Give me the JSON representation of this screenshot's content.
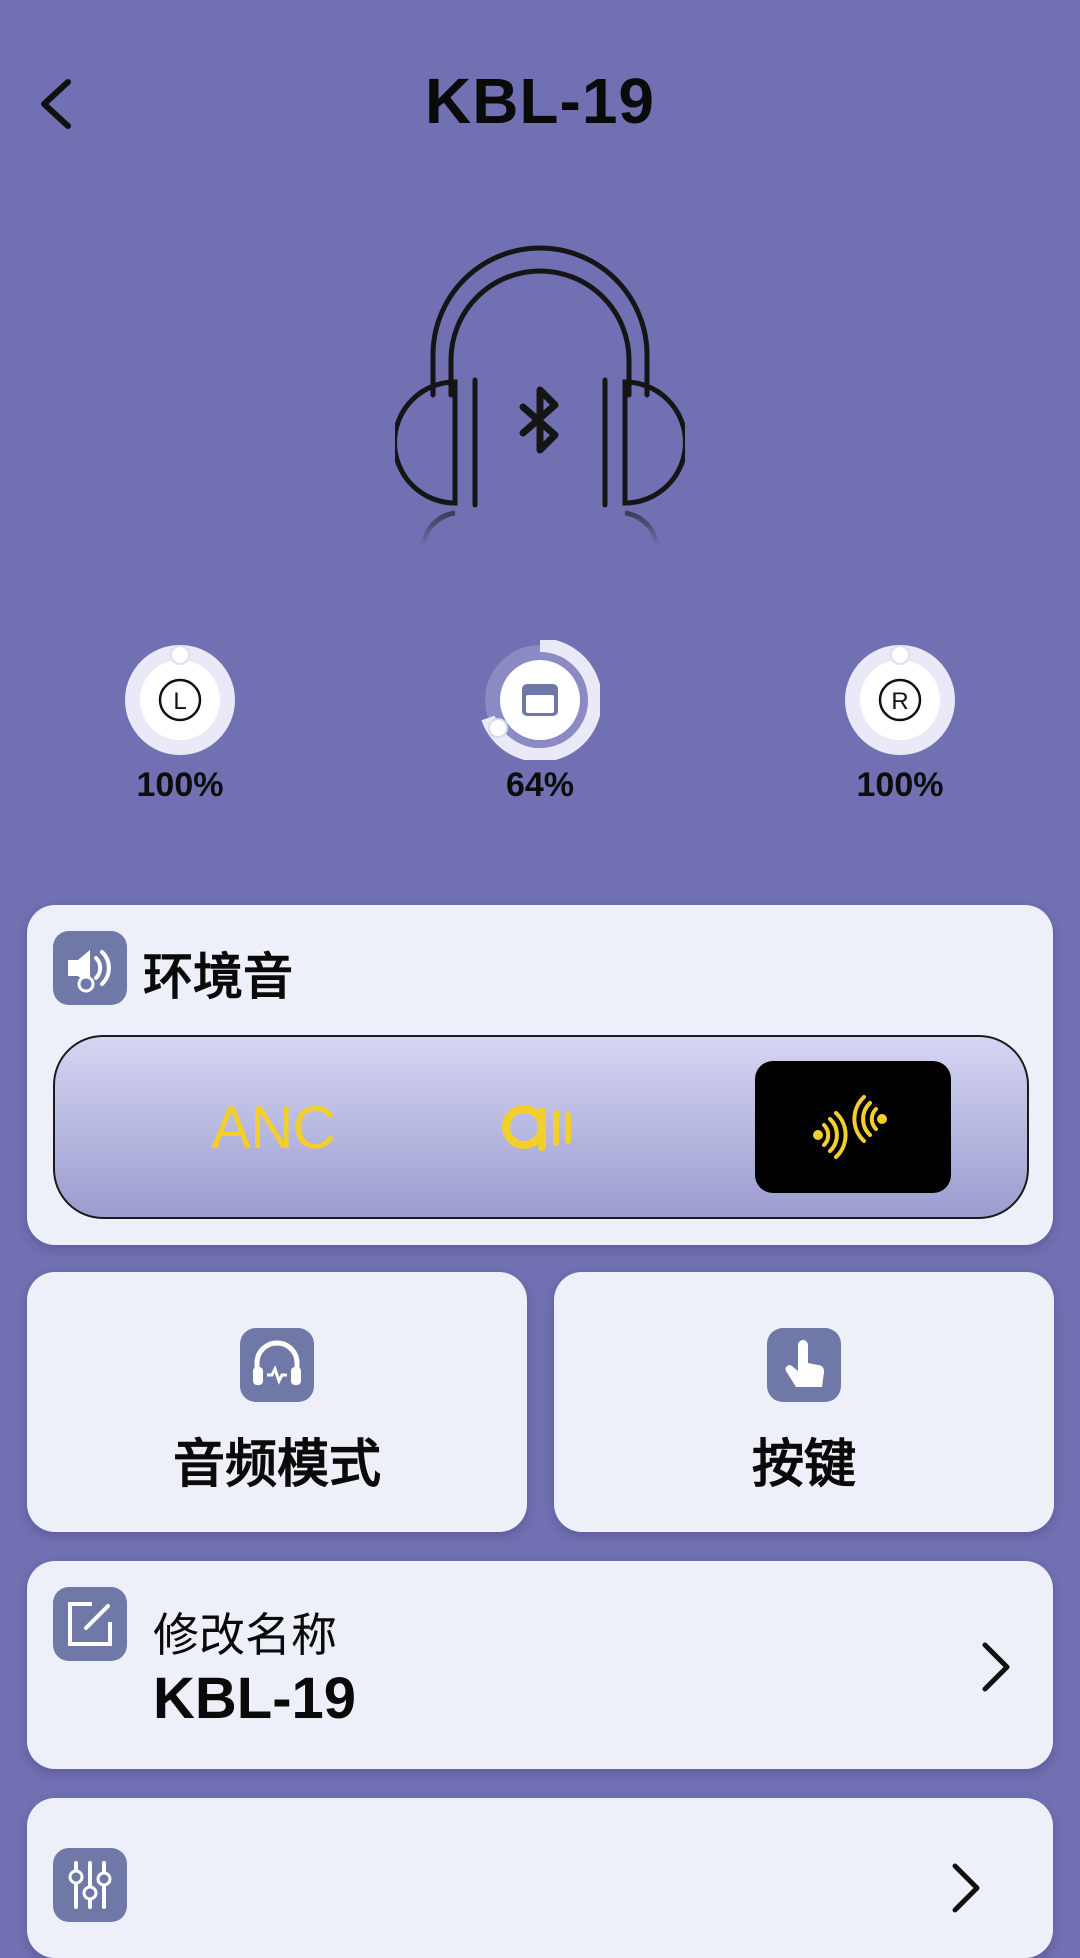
{
  "header": {
    "title": "KBL-19"
  },
  "battery": {
    "left": {
      "label": "L",
      "percent_text": "100%",
      "level": 1.0
    },
    "case": {
      "percent_text": "64%",
      "level": 0.64
    },
    "right": {
      "label": "R",
      "percent_text": "100%",
      "level": 1.0
    }
  },
  "ambient": {
    "title": "环境音",
    "modes": [
      {
        "name": "anc",
        "label": "ANC",
        "selected": false
      },
      {
        "name": "aware",
        "icon": "ambient-aware-icon",
        "selected": false
      },
      {
        "name": "transparency",
        "icon": "transparency-icon",
        "selected": true
      }
    ]
  },
  "tiles": {
    "audio_mode": "音频模式",
    "keys": "按键"
  },
  "rename": {
    "label": "修改名称",
    "value": "KBL-19"
  },
  "colors": {
    "background": "#7070b2",
    "card": "#eef0f9",
    "icon_tile": "#6f78a6",
    "accent_yellow": "#f3cf2c"
  }
}
